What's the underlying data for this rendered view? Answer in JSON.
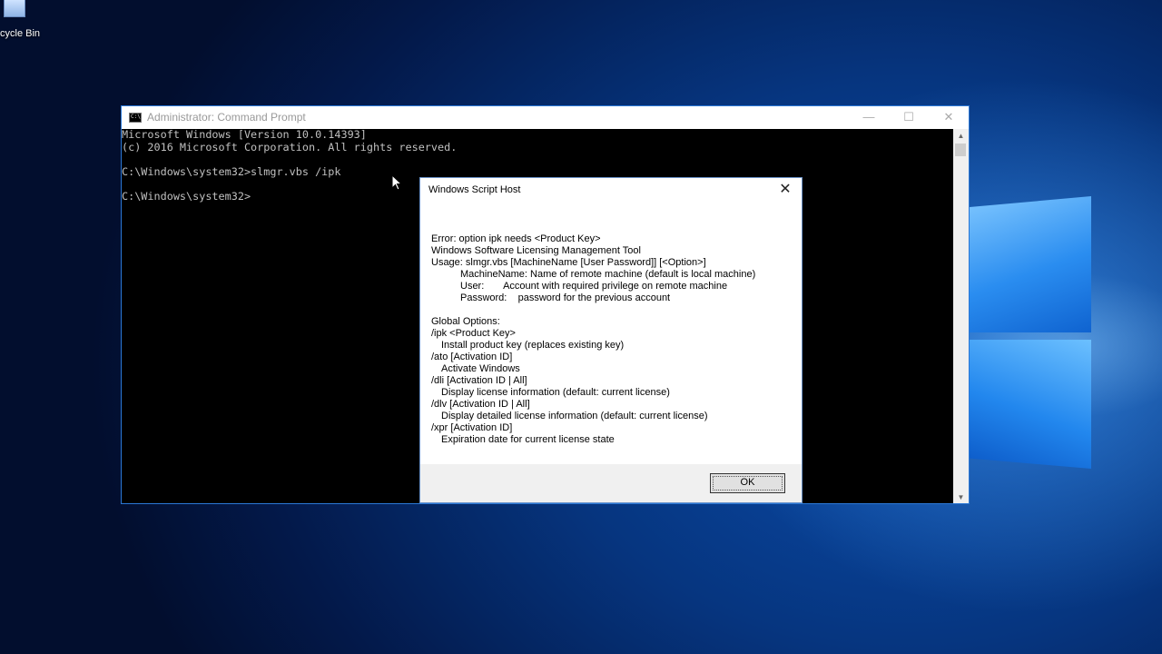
{
  "desktop": {
    "icon_label": "cycle Bin"
  },
  "cmd_window": {
    "title": "Administrator: Command Prompt",
    "controls": {
      "minimize": "—",
      "maximize": "☐",
      "close": "✕"
    },
    "lines": [
      "Microsoft Windows [Version 10.0.14393]",
      "(c) 2016 Microsoft Corporation. All rights reserved.",
      "",
      "C:\\Windows\\system32>slmgr.vbs /ipk",
      "",
      "C:\\Windows\\system32>"
    ]
  },
  "dialog": {
    "title": "Windows Script Host",
    "close": "✕",
    "lines": [
      {
        "text": "Error: option ipk needs <Product Key>",
        "indent": 0
      },
      {
        "text": "Windows Software Licensing Management Tool",
        "indent": 0
      },
      {
        "text": "Usage: slmgr.vbs [MachineName [User Password]] [<Option>]",
        "indent": 0
      },
      {
        "text": "MachineName: Name of remote machine (default is local machine)",
        "indent": 1
      },
      {
        "text": "User:       Account with required privilege on remote machine",
        "indent": 1
      },
      {
        "text": "Password:    password for the previous account",
        "indent": 1
      },
      {
        "text": "",
        "indent": 0
      },
      {
        "text": "Global Options:",
        "indent": 0
      },
      {
        "text": "/ipk <Product Key>",
        "indent": 0
      },
      {
        "text": "Install product key (replaces existing key)",
        "indent": 2
      },
      {
        "text": "/ato [Activation ID]",
        "indent": 0
      },
      {
        "text": "Activate Windows",
        "indent": 2
      },
      {
        "text": "/dli [Activation ID | All]",
        "indent": 0
      },
      {
        "text": "Display license information (default: current license)",
        "indent": 2
      },
      {
        "text": "/dlv [Activation ID | All]",
        "indent": 0
      },
      {
        "text": "Display detailed license information (default: current license)",
        "indent": 2
      },
      {
        "text": "/xpr [Activation ID]",
        "indent": 0
      },
      {
        "text": "Expiration date for current license state",
        "indent": 2
      }
    ],
    "ok_label": "OK"
  }
}
